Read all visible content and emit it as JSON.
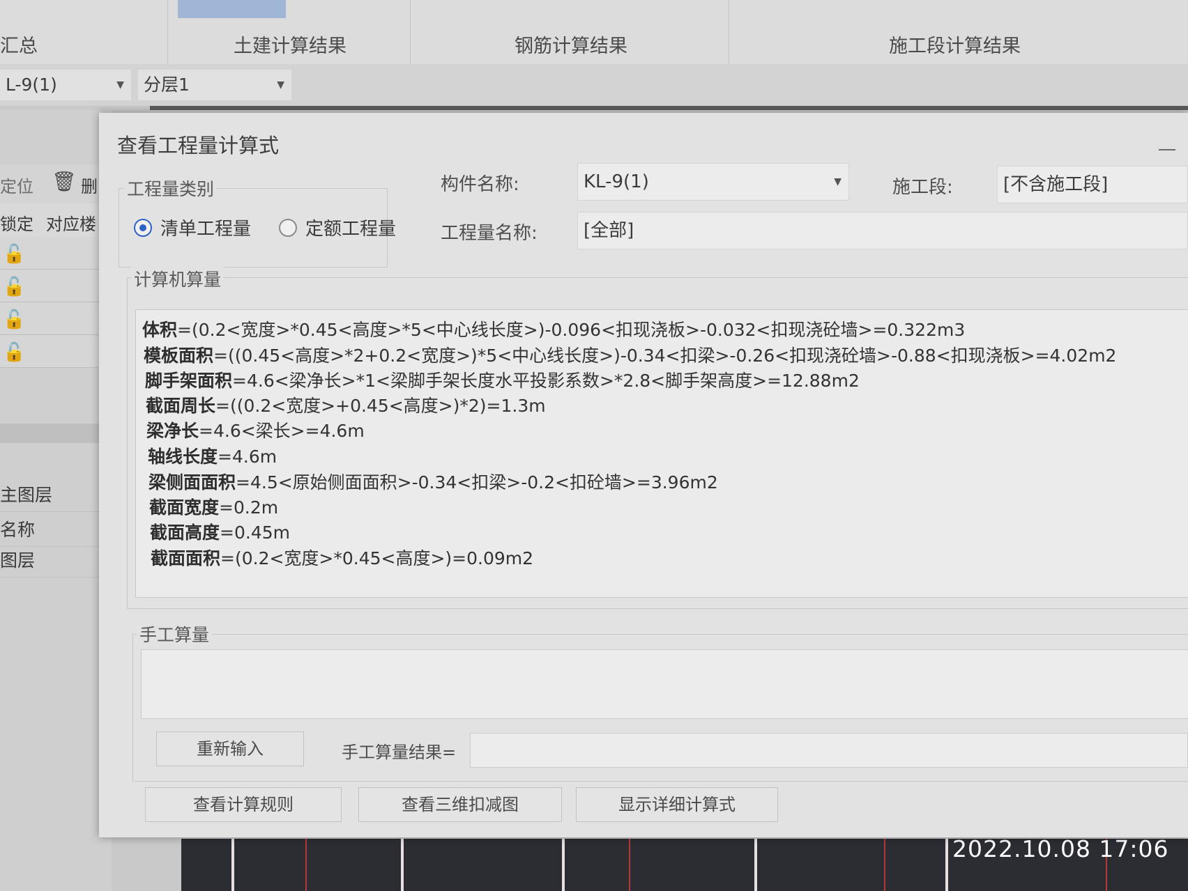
{
  "background": {
    "tabs": [
      {
        "label": "汇总"
      },
      {
        "label": "土建计算结果"
      },
      {
        "label": "钢筋计算结果"
      },
      {
        "label": "施工段计算结果"
      }
    ],
    "component_select": "L-9(1)",
    "layer_select": "分层1",
    "left_panel": {
      "toolbar_locate": "定位",
      "toolbar_delete": "删",
      "header_lock": "锁定",
      "header_floor": "对应楼",
      "props": [
        "主图层",
        "名称",
        "图层"
      ]
    },
    "timestamp": "2022.10.08 17:06"
  },
  "dialog": {
    "title": "查看工程量计算式",
    "quantity_type": {
      "label": "工程量类别",
      "options": [
        "清单工程量",
        "定额工程量"
      ],
      "selected": "清单工程量"
    },
    "component_name_label": "构件名称:",
    "component_name_value": "KL-9(1)",
    "construction_section_label": "施工段:",
    "construction_section_value": "[不含施工段]",
    "quantity_name_label": "工程量名称:",
    "quantity_name_value": "[全部]",
    "computer_calc": {
      "label": "计算机算量",
      "lines": [
        {
          "name": "体积",
          "expr": "=(0.2<宽度>*0.45<高度>*5<中心线长度>)-0.096<扣现浇板>-0.032<扣现浇砼墙>=0.322m3"
        },
        {
          "name": "模板面积",
          "expr": "=((0.45<高度>*2+0.2<宽度>)*5<中心线长度>)-0.34<扣梁>-0.26<扣现浇砼墙>-0.88<扣现浇板>=4.02m2"
        },
        {
          "name": "脚手架面积",
          "expr": "=4.6<梁净长>*1<梁脚手架长度水平投影系数>*2.8<脚手架高度>=12.88m2"
        },
        {
          "name": "截面周长",
          "expr": "=((0.2<宽度>+0.45<高度>)*2)=1.3m"
        },
        {
          "name": "梁净长",
          "expr": "=4.6<梁长>=4.6m"
        },
        {
          "name": "轴线长度",
          "expr": "=4.6m"
        },
        {
          "name": "梁侧面面积",
          "expr": "=4.5<原始侧面面积>-0.34<扣梁>-0.2<扣砼墙>=3.96m2"
        },
        {
          "name": "截面宽度",
          "expr": "=0.2m"
        },
        {
          "name": "截面高度",
          "expr": "=0.45m"
        },
        {
          "name": "截面面积",
          "expr": "=(0.2<宽度>*0.45<高度>)=0.09m2"
        }
      ]
    },
    "manual_calc": {
      "label": "手工算量",
      "reinput_button": "重新输入",
      "result_label": "手工算量结果=",
      "result_value": ""
    },
    "buttons": {
      "view_rules": "查看计算规则",
      "view_3d": "查看三维扣减图",
      "show_detail": "显示详细计算式"
    }
  }
}
